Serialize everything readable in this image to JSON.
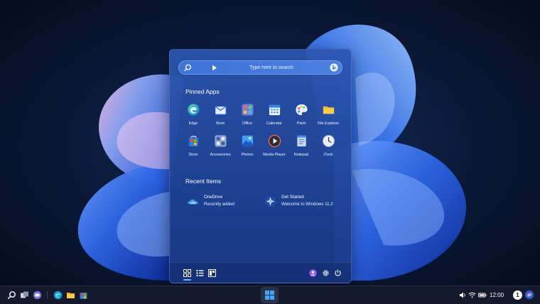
{
  "start_menu": {
    "search": {
      "placeholder": "Type here to search"
    },
    "pinned_title": "Pinned Apps",
    "pinned_apps": [
      {
        "label": "Edge",
        "icon": "edge-icon"
      },
      {
        "label": "Store",
        "icon": "store-icon"
      },
      {
        "label": "Office",
        "icon": "office-icon"
      },
      {
        "label": "Calendar",
        "icon": "calendar-icon"
      },
      {
        "label": "Paint",
        "icon": "paint-icon"
      },
      {
        "label": "File Explorer",
        "icon": "folder-icon"
      },
      {
        "label": "Store",
        "icon": "store-icon"
      },
      {
        "label": "Accessories",
        "icon": "accessories-icon"
      },
      {
        "label": "Photos",
        "icon": "photos-icon"
      },
      {
        "label": "Media Player",
        "icon": "media-player-icon"
      },
      {
        "label": "Notepad",
        "icon": "notepad-icon"
      },
      {
        "label": "Clock",
        "icon": "clock-icon"
      }
    ],
    "recent_title": "Recent Items",
    "recent_items": [
      {
        "name": "OneDrive",
        "sub": "Recently added",
        "icon": "onedrive-icon"
      },
      {
        "name": "Get Started",
        "sub": "Welcome to Windows 11.2",
        "icon": "get-started-icon"
      }
    ]
  },
  "taskbar": {
    "clock": "12:00",
    "notification_count": "1"
  },
  "colors": {
    "accent": "#3b78e7",
    "menu_background": "#2c56b0",
    "taskbar_background": "#141a2b"
  }
}
